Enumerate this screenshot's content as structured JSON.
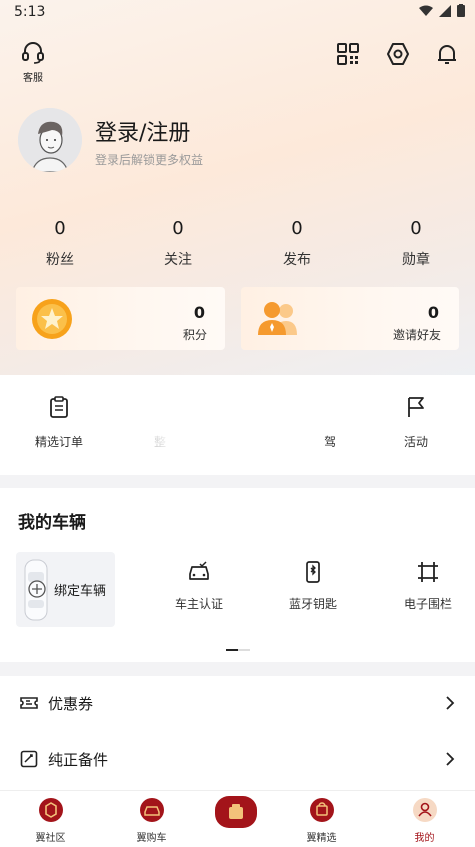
{
  "status": {
    "time": "5:13"
  },
  "header": {
    "service_label": "客服",
    "icons": [
      "headset-icon",
      "qr-scan-icon",
      "settings-icon",
      "bell-icon"
    ]
  },
  "profile": {
    "title": "登录/注册",
    "subtitle": "登录后解锁更多权益"
  },
  "stats": [
    {
      "value": "0",
      "label": "粉丝"
    },
    {
      "value": "0",
      "label": "关注"
    },
    {
      "value": "0",
      "label": "发布"
    },
    {
      "value": "0",
      "label": "勋章"
    }
  ],
  "cards": [
    {
      "value": "0",
      "label": "积分"
    },
    {
      "value": "0",
      "label": "邀请好友"
    }
  ],
  "quick_menu": [
    {
      "label": "精选订单"
    },
    {
      "label": "整"
    },
    {
      "label": "驾"
    },
    {
      "label": "活动"
    }
  ],
  "vehicles": {
    "title": "我的车辆",
    "bind_label": "绑定车辆",
    "items": [
      {
        "label": "车主认证"
      },
      {
        "label": "蓝牙钥匙"
      },
      {
        "label": "电子围栏"
      }
    ]
  },
  "list": [
    {
      "label": "优惠券"
    },
    {
      "label": "纯正备件"
    }
  ],
  "tabs": [
    {
      "label": "翼社区"
    },
    {
      "label": "翼购车"
    },
    {
      "label": "翼精选"
    },
    {
      "label": "我的"
    }
  ],
  "colors": {
    "brand_red": "#a3141a",
    "accent_orange": "#f5a623"
  }
}
